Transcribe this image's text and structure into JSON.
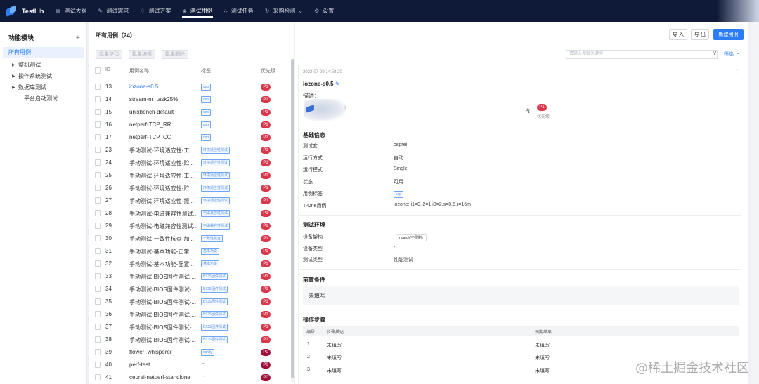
{
  "app": {
    "name": "TestLib"
  },
  "nav": [
    {
      "label": "测试大纲",
      "icon": "document-icon"
    },
    {
      "label": "测试需求",
      "icon": "edit-icon"
    },
    {
      "label": "测试方案",
      "icon": "bulb-icon"
    },
    {
      "label": "测试用例",
      "icon": "layers-icon",
      "active": true
    },
    {
      "label": "测试任务",
      "icon": "network-icon"
    },
    {
      "label": "采购检测",
      "icon": "refresh-icon",
      "dropdown": true
    },
    {
      "label": "设置",
      "icon": "gear-icon"
    }
  ],
  "sidebar": {
    "title": "功能模块",
    "add": "+",
    "all": "所有用例",
    "items": [
      {
        "label": "整机测试",
        "expandable": true
      },
      {
        "label": "操作系统测试",
        "expandable": true
      },
      {
        "label": "数据库测试",
        "expandable": true
      },
      {
        "label": "平台启动测试",
        "expandable": false
      }
    ]
  },
  "list": {
    "title": "所有用例（24）",
    "bulk": [
      "批量移动",
      "批量编辑",
      "批量删除"
    ],
    "headers": {
      "id": "ID",
      "name": "用例名称",
      "tag": "标签",
      "priority": "优先级"
    },
    "rows": [
      {
        "id": "13",
        "name": "iozone-s0.5",
        "tag": "cep",
        "priority": "P1",
        "selected": true
      },
      {
        "id": "14",
        "name": "stream-nr_task25%",
        "tag": "cep",
        "priority": "P1"
      },
      {
        "id": "15",
        "name": "unixbench-default",
        "tag": "cep",
        "priority": "P1"
      },
      {
        "id": "16",
        "name": "netperf-TCP_RR",
        "tag": "cep",
        "priority": "P1"
      },
      {
        "id": "17",
        "name": "netperf-TCP_CC",
        "tag": "cep",
        "priority": "P1"
      },
      {
        "id": "23",
        "name": "手动测试-环境适应性-工...",
        "tag": "环境适应性测试",
        "priority": "P1"
      },
      {
        "id": "24",
        "name": "手动测试-环境适应性-贮...",
        "tag": "环境适应性测试",
        "priority": "P1"
      },
      {
        "id": "25",
        "name": "手动测试-环境适应性-工...",
        "tag": "环境适应性测试",
        "priority": "P1"
      },
      {
        "id": "26",
        "name": "手动测试-环境适应性-贮...",
        "tag": "环境适应性测试",
        "priority": "P1"
      },
      {
        "id": "27",
        "name": "手动测试-环境适应性-振...",
        "tag": "环境适应性测试",
        "priority": "P1"
      },
      {
        "id": "28",
        "name": "手动测试-电磁兼容性测试...",
        "tag": "电磁兼容性测试",
        "priority": "P1"
      },
      {
        "id": "29",
        "name": "手动测试-电磁兼容性测试...",
        "tag": "电磁兼容性测试",
        "priority": "P1"
      },
      {
        "id": "30",
        "name": "手动测试-一致性核查-加...",
        "tag": "一致性核查",
        "priority": "P1"
      },
      {
        "id": "31",
        "name": "手动测试-基本功能-正常...",
        "tag": "基本功能",
        "priority": "P1"
      },
      {
        "id": "32",
        "name": "手动测试-基本功能-配置...",
        "tag": "基本功能",
        "priority": "P1"
      },
      {
        "id": "33",
        "name": "手动测试-BIOS固件测试-...",
        "tag": "BIOS固件测试",
        "priority": "P1"
      },
      {
        "id": "34",
        "name": "手动测试-BIOS固件测试-...",
        "tag": "BIOS固件测试",
        "priority": "P1"
      },
      {
        "id": "35",
        "name": "手动测试-BIOS固件测试-...",
        "tag": "BIOS固件测试",
        "priority": "P1"
      },
      {
        "id": "36",
        "name": "手动测试-BIOS固件测试-...",
        "tag": "BIOS固件测试",
        "priority": "P1"
      },
      {
        "id": "37",
        "name": "手动测试-BIOS固件测试-...",
        "tag": "BIOS固件测试",
        "priority": "P1"
      },
      {
        "id": "38",
        "name": "手动测试-BIOS固件测试-...",
        "tag": "BIOS固件测试",
        "priority": "P1"
      },
      {
        "id": "39",
        "name": "flower_whisperer",
        "tag": "sanity",
        "priority": "P0"
      },
      {
        "id": "40",
        "name": "perf-test",
        "tag": "-",
        "priority": "P0"
      },
      {
        "id": "41",
        "name": "ceprei-netperf-standlone",
        "tag": "-",
        "priority": "P0"
      }
    ]
  },
  "toolbar": {
    "import": "导 入",
    "export": "导 出",
    "new_case": "新建用例",
    "search_placeholder": "请输入搜索关键字",
    "filter": "筛选"
  },
  "detail": {
    "timestamp": "2022-07-29 14:58:20",
    "more": "⋮",
    "title": "iozone-s0.5",
    "desc_label": "描述：",
    "blurred_text": "g",
    "priority": "P1",
    "priority_caption": "优先级",
    "basic": {
      "title": "基础信息",
      "fields": [
        {
          "key": "测试套",
          "value": "ceprei"
        },
        {
          "key": "运行方式",
          "value": "自动"
        },
        {
          "key": "运行模式",
          "value": "Single"
        },
        {
          "key": "状态",
          "value": "可用"
        },
        {
          "key": "用例标签",
          "value": "cep",
          "is_tag": true
        },
        {
          "key": "T-One用例",
          "value": "iozone: i1=0,i2=1,i3=2,s=0.5,r=16m"
        }
      ]
    },
    "env": {
      "title": "测试环境",
      "fields": [
        {
          "key": "设备架构",
          "value": "noarch(不限制)",
          "is_pill": true
        },
        {
          "key": "设备类型",
          "value": "-"
        },
        {
          "key": "测试类型",
          "value": "性能测试"
        }
      ]
    },
    "precondition": {
      "title": "前置条件",
      "value": "未填写"
    },
    "steps": {
      "title": "操作步骤",
      "headers": {
        "no": "编号",
        "desc": "步骤描述",
        "expect": "预期结果"
      },
      "rows": [
        {
          "no": "1",
          "desc": "未填写",
          "expect": "未填写"
        },
        {
          "no": "2",
          "desc": "未填写",
          "expect": "未填写"
        },
        {
          "no": "3",
          "desc": "未填写",
          "expect": "未填写"
        }
      ]
    }
  },
  "watermark": "@稀土掘金技术社区"
}
